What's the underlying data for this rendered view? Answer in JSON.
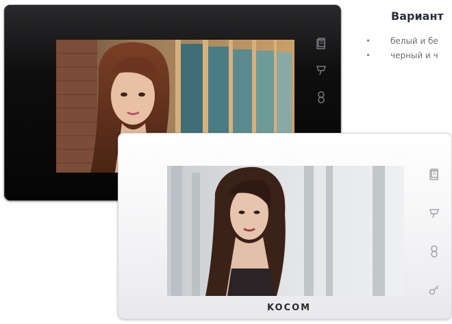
{
  "variants": {
    "title": "Вариант",
    "items": [
      {
        "bullet": "•",
        "text": "белый и бе"
      },
      {
        "bullet": "•",
        "text": "черный и ч"
      }
    ]
  },
  "black_monitor": {
    "color": "#0a0a0a",
    "icons": [
      "memo-icon",
      "camera-icon",
      "intercom-icon"
    ]
  },
  "white_monitor": {
    "color": "#f4f4f6",
    "brand": "KOCOM",
    "icons": [
      "memo-icon",
      "camera-icon",
      "intercom-icon",
      "door-key-icon"
    ]
  }
}
